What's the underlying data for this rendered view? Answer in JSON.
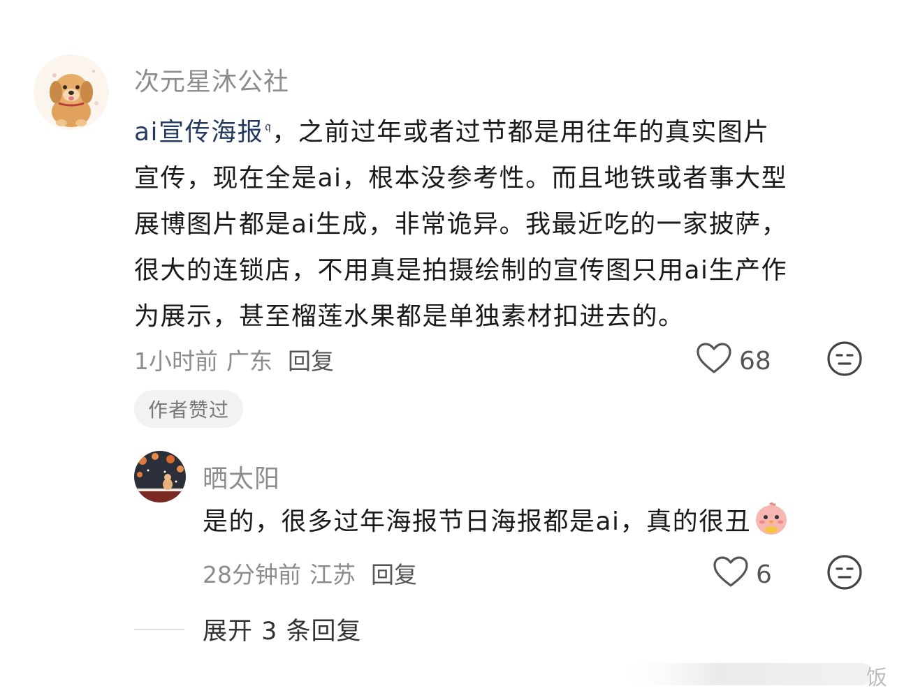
{
  "comment": {
    "author": "次元星沐公社",
    "link_text": "ai宣传海报",
    "lines": [
      "，之前过年或者过节都是用往年的真实图片",
      "宣传，现在全是ai，根本没参考性。而且地铁或者事大型",
      "展博图片都是ai生成，非常诡异。我最近吃的一家披萨，",
      "很大的连锁店，不用真是拍摄绘制的宣传图只用ai生产作",
      "为展示，甚至榴莲水果都是单独素材扣进去的。"
    ],
    "time": "1小时前",
    "location": "广东",
    "reply_label": "回复",
    "like_count": "68",
    "author_liked_badge": "作者赞过"
  },
  "reply": {
    "author": "晒太阳",
    "text": "是的，很多过年海报节日海报都是ai，真的很丑",
    "time": "28分钟前",
    "location": "江苏",
    "reply_label": "回复",
    "like_count": "6"
  },
  "expand_replies": "展开 3 条回复",
  "watermark": "饭",
  "colors": {
    "link": "#243a63",
    "meta": "#8c8c8c",
    "badge_bg": "#f2f2f2"
  },
  "icons": {
    "search": "search-icon",
    "like": "heart-outline-icon",
    "reaction": "neutral-face-emoji-icon",
    "inline_emoji": "chick-emoji-icon"
  }
}
